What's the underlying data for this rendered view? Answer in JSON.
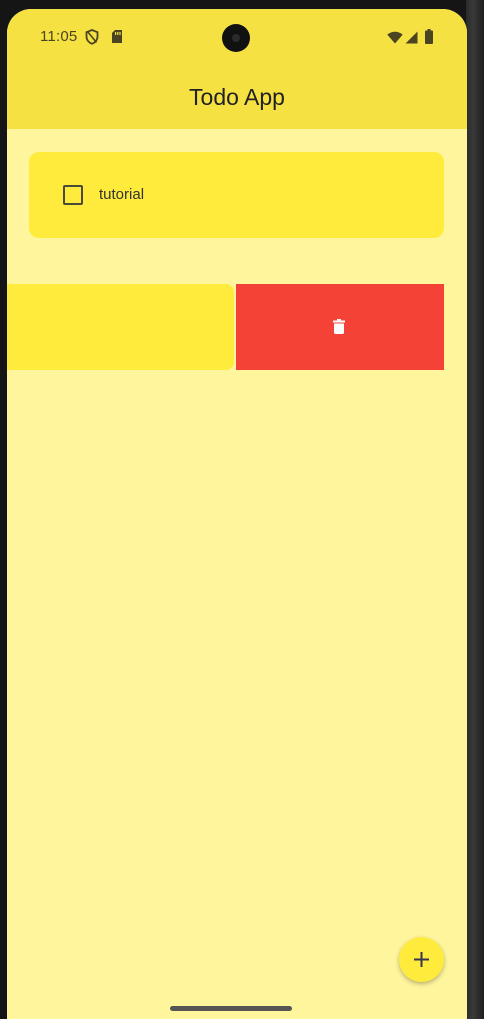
{
  "status_bar": {
    "time": "11:05",
    "left_icons": [
      "shield-icon",
      "sd-card-icon"
    ],
    "right_icons": [
      "wifi-icon",
      "signal-icon",
      "battery-icon"
    ]
  },
  "app_bar": {
    "title": "Todo App",
    "color": "#F5E142"
  },
  "todos": [
    {
      "label": "tutorial",
      "checked": false
    }
  ],
  "swipe_action": {
    "icon": "trash-icon",
    "color": "#F44336"
  },
  "fab": {
    "icon": "plus-icon",
    "color": "#FFEB3B"
  },
  "colors": {
    "background": "#FFF59D",
    "card": "#FFEB3B"
  }
}
